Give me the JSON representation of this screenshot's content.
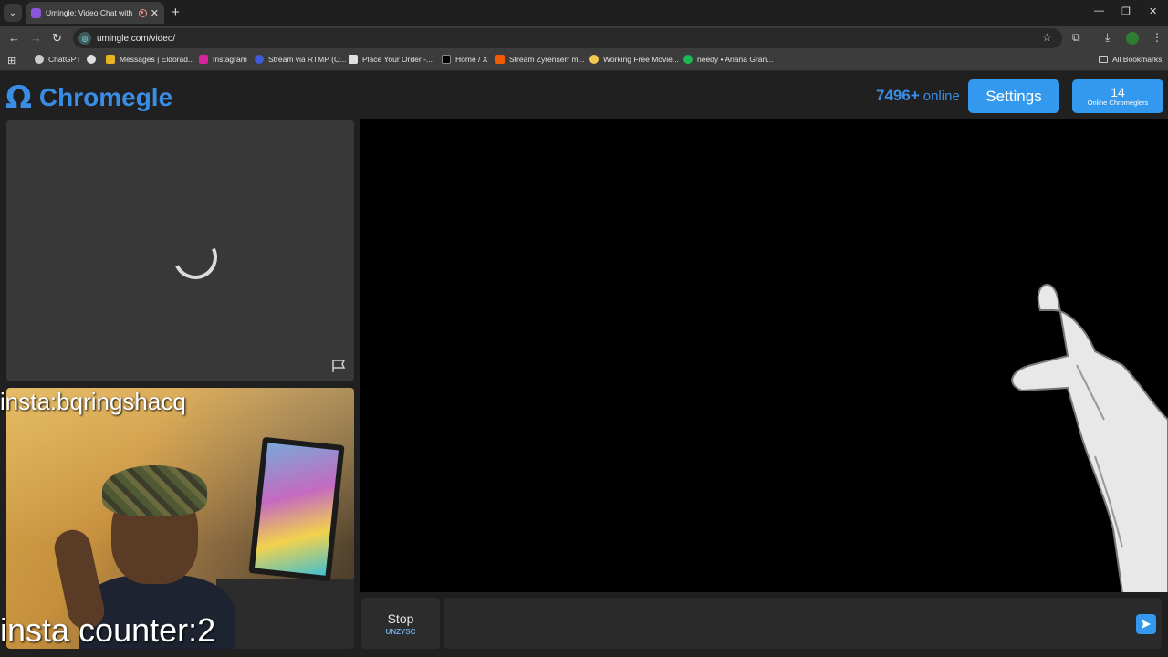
{
  "browser": {
    "tab": {
      "title": "Umingle: Video Chat with S",
      "close": "✕"
    },
    "new_tab": "+",
    "window_controls": {
      "minimize": "—",
      "restore": "❐",
      "close": "✕"
    },
    "nav": {
      "back": "←",
      "forward": "→",
      "reload": "↻"
    },
    "url": "umingle.com/video/",
    "bookmarks": [
      {
        "label": "ChatGPT",
        "color": "#cccccc"
      },
      {
        "label": "",
        "color": "#e0e0e0"
      },
      {
        "label": "Messages | Eldorad...",
        "color": "#e6b422"
      },
      {
        "label": "Instagram",
        "color": "#d6249f"
      },
      {
        "label": "Stream via RTMP (O...",
        "color": "#3b5bdb"
      },
      {
        "label": "Place Your Order -...",
        "color": "#e0e0e0"
      },
      {
        "label": "Home / X",
        "color": "#000000"
      },
      {
        "label": "Stream Zyrenserr m...",
        "color": "#f25c05"
      },
      {
        "label": "Working Free Movie...",
        "color": "#f2c94c"
      },
      {
        "label": "needy • Ariana Gran...",
        "color": "#1db954"
      }
    ],
    "all_bookmarks": "All Bookmarks"
  },
  "site": {
    "logo_symbol": "Ω",
    "logo_text": "Chromegle",
    "online_count": "7496+",
    "online_label": "online",
    "settings_label": "Settings",
    "chromeglers_count": "14",
    "chromeglers_label": "Online Chromeglers"
  },
  "self_video": {
    "overlay_handle": "insta:bqringshacq",
    "overlay_counter": "insta counter:2"
  },
  "controls": {
    "stop_label": "Stop",
    "stop_sub": "UNZYSC",
    "chat_placeholder": ""
  },
  "colors": {
    "accent": "#3399ee",
    "logo": "#3a8de5",
    "page_bg": "#202020"
  }
}
